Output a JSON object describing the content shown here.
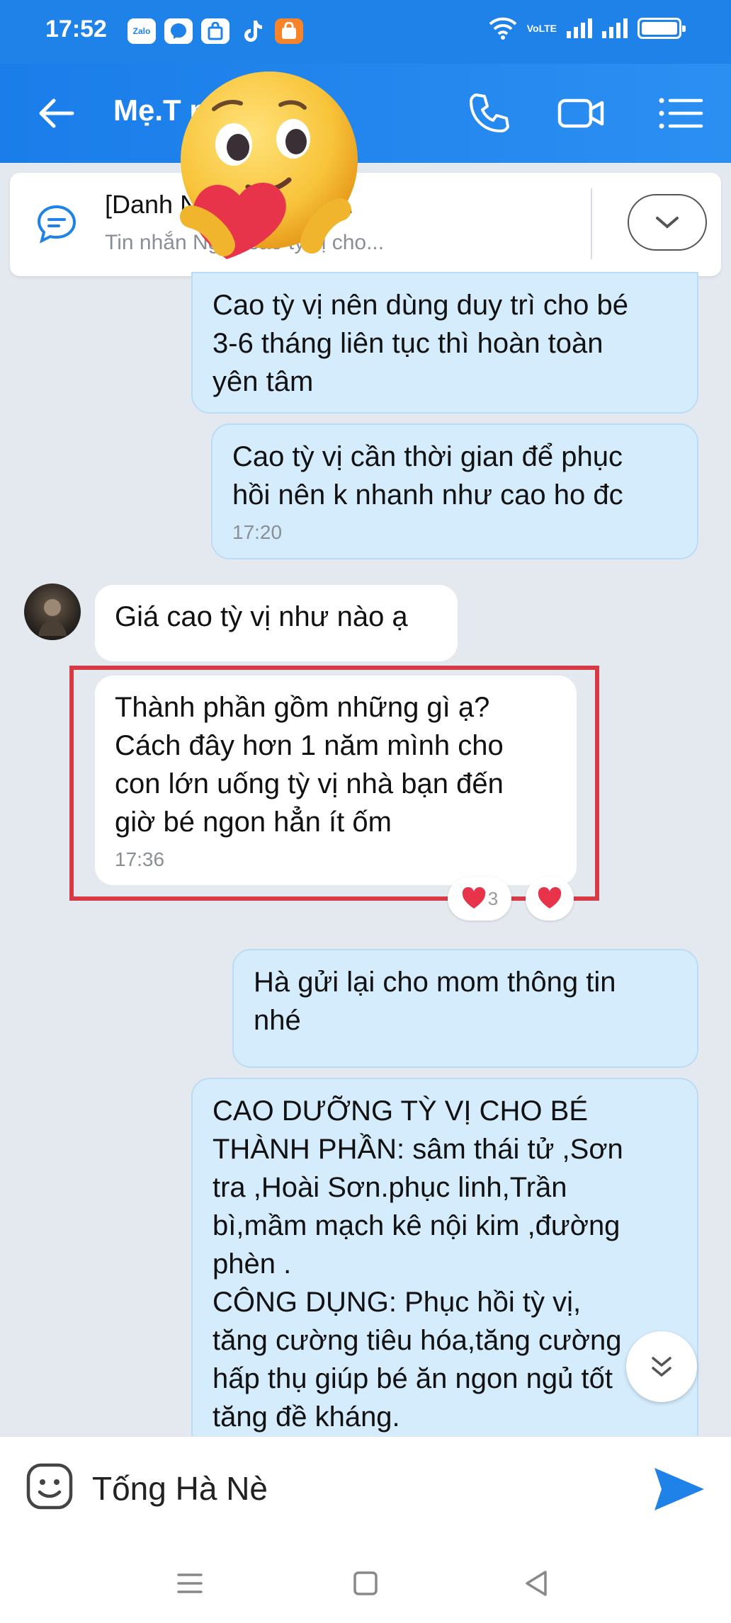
{
  "status_bar": {
    "time": "17:52",
    "app_icons": [
      "Zalo",
      "messenger",
      "shop",
      "tiktok",
      "shopee"
    ],
    "network_label": "VoLTE",
    "colors": {
      "bg": "#1e82e8"
    }
  },
  "header": {
    "title": "Mẹ.T     no...",
    "icons": [
      "back-arrow-icon",
      "phone-icon",
      "video-call-icon",
      "menu-list-icon"
    ]
  },
  "pinned": {
    "title": "[Danh          Ngọc.cao tỳ v...",
    "subtitle": "Tin nhắn          Ngọc.cao tỳ vị cho..."
  },
  "messages": [
    {
      "direction": "out",
      "text": "Cao tỳ vị nên dùng duy trì cho bé\n3-6 tháng liên tục thì hoàn toàn\nyên tâm"
    },
    {
      "direction": "out",
      "text": "Cao tỳ vị cần thời gian để phục\nhồi nên k nhanh như cao ho đc",
      "time": "17:20"
    },
    {
      "direction": "in",
      "text": "Giá cao tỳ vị như nào ạ"
    },
    {
      "direction": "in",
      "text": "Thành phần gồm những gì ạ?\nCách đây hơn 1 năm mình cho\ncon lớn uống tỳ vị nhà bạn đến\ngiờ bé ngon hẳn ít ốm",
      "time": "17:36",
      "reactions": {
        "count": "3"
      }
    },
    {
      "direction": "out",
      "text": "Hà gửi lại cho mom thông tin\nnhé"
    },
    {
      "direction": "out",
      "text": "CAO DƯỠNG TỲ VỊ CHO BÉ\nTHÀNH PHẦN: sâm thái tử ,Sơn\ntra ,Hoài Sơn.phục linh,Trần\nbì,mầm mạch kê nội kim ,đường\nphèn .\nCÔNG DỤNG: Phục hồi tỳ vị,\ntăng cường tiêu hóa,tăng cường\nhấp thụ giúp bé ăn ngon ngủ tốt\ntăng đề kháng."
    }
  ],
  "composer": {
    "value": "Tống Hà Nè"
  },
  "colors": {
    "accent": "#1e82e8",
    "outgoing_bubble": "#d5ecfd",
    "incoming_bubble": "#ffffff",
    "highlight_border": "#d63a45",
    "heart": "#e8344a"
  }
}
